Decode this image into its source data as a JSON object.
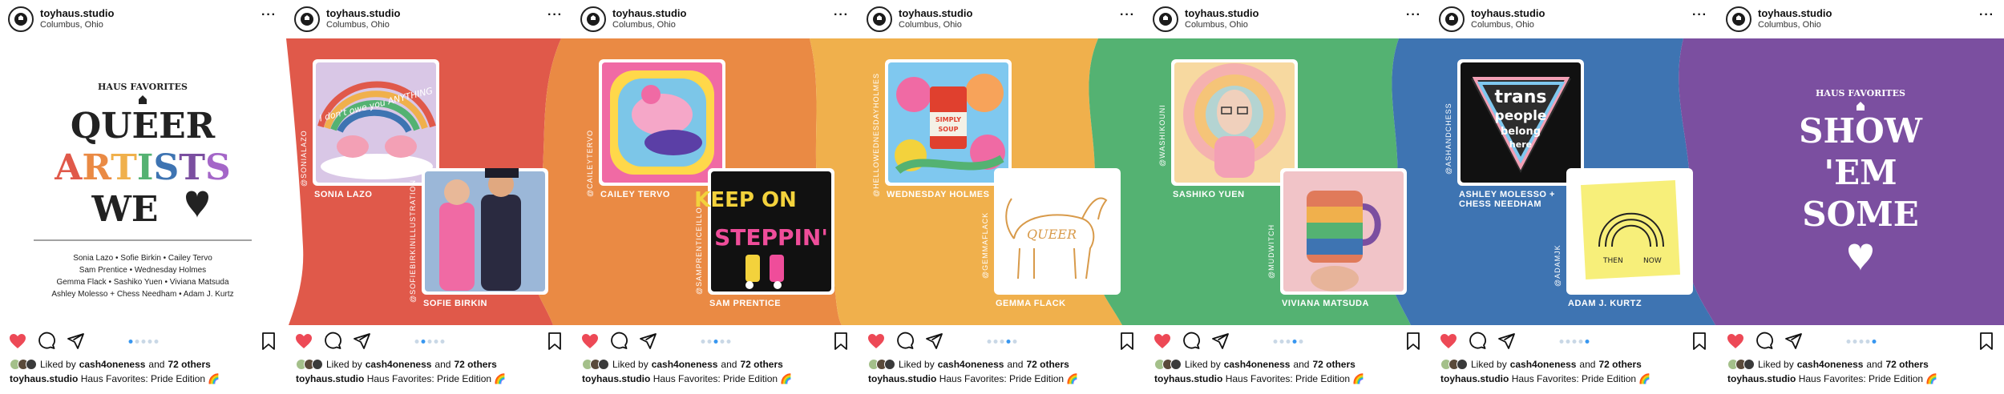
{
  "account": {
    "username": "toyhaus.studio",
    "location": "Columbus, Ohio",
    "more_icon": "more-horizontal-icon"
  },
  "engagement": {
    "liked_by_prefix": "Liked by",
    "liked_by_user": "cash4oneness",
    "and_text": "and",
    "others": "72 others"
  },
  "caption": {
    "username": "toyhaus.studio",
    "text": "Haus Favorites: Pride Edition 🌈"
  },
  "icons": [
    "heart-icon",
    "comment-icon",
    "share-icon",
    "bookmark-icon"
  ],
  "colors": {
    "red": "#e0594a",
    "orange": "#ea8a44",
    "yellow": "#f0b04c",
    "green": "#54b272",
    "blue": "#3e74b2",
    "purple": "#7b4fa0",
    "heart_liked": "#ed4956",
    "dot_active": "#3897f0"
  },
  "slide1": {
    "kicker": "HAUS FAVORITES",
    "title_line1": "QUEER",
    "title_line2": "ARTISTS",
    "title_line3": "WE",
    "list": [
      "Sonia Lazo  •  Sofie Birkin  •  Cailey Tervo",
      "Sam Prentice  •  Wednesday Holmes",
      "Gemma Flack  •  Sashiko Yuen  •  Viviana Matsuda",
      "Ashley Molesso + Chess Needham  •  Adam J. Kurtz"
    ]
  },
  "artists": [
    {
      "name": "SONIA LAZO",
      "handle": "@SONIALAZO"
    },
    {
      "name": "SOFIE BIRKIN",
      "handle": "@SOFIEBIRKINILLUSTRATION"
    },
    {
      "name": "CAILEY TERVO",
      "handle": "@CAILEYTERVO"
    },
    {
      "name": "SAM PRENTICE",
      "handle": "@SAMPRENTICEILLO"
    },
    {
      "name": "WEDNESDAY HOLMES",
      "handle": "@HELLOWEDNESDAYHOLMES"
    },
    {
      "name": "GEMMA FLACK",
      "handle": "@GEMMAFLACK"
    },
    {
      "name": "SASHIKO YUEN",
      "handle": "@WASHIKOUNI"
    },
    {
      "name": "VIVIANA MATSUDA",
      "handle": "@MUDWITCH"
    },
    {
      "name": "ASHLEY MOLESSO +",
      "name2": "CHESS NEEDHAM",
      "handle": "@ASHANDCHESS"
    },
    {
      "name": "ADAM J. KURTZ",
      "handle": "@ADAMJK"
    }
  ],
  "artwork_text": {
    "sonia": "I don't owe you ANYTHING",
    "sam_1": "KEEP ON",
    "sam_2": "STEPPIN'",
    "wednesday_can_1": "SIMPLY",
    "wednesday_can_2": "SOUP",
    "gemma": "QUEER",
    "ashley_1": "trans",
    "ashley_2": "people",
    "ashley_3": "belong",
    "ashley_4": "here",
    "adam_then": "THEN",
    "adam_now": "NOW"
  },
  "slide7": {
    "kicker": "HAUS FAVORITES",
    "line1": "SHOW",
    "line2": "'EM",
    "line3": "SOME"
  }
}
